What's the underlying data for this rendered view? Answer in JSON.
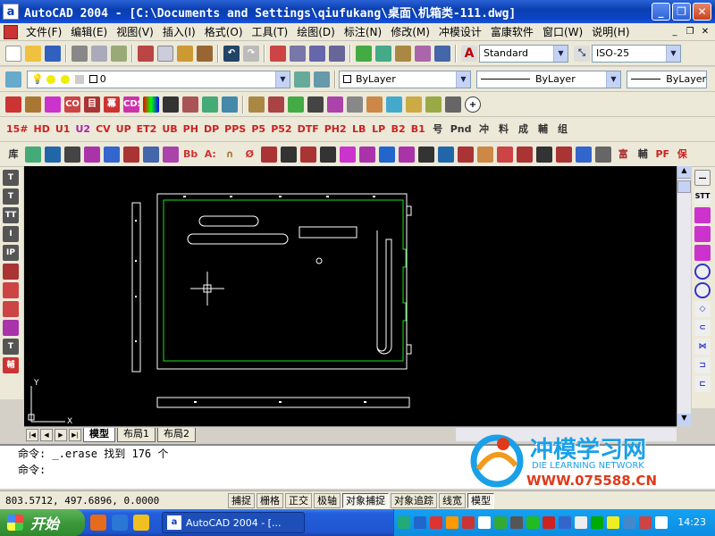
{
  "window": {
    "title": "AutoCAD 2004 - [C:\\Documents and Settings\\qiufukang\\桌面\\机箱类-111.dwg]",
    "app_icon": "a",
    "minimize_label": "_",
    "maximize_label": "❐",
    "close_label": "✕"
  },
  "menu": {
    "items": [
      "文件(F)",
      "编辑(E)",
      "视图(V)",
      "插入(I)",
      "格式(O)",
      "工具(T)",
      "绘图(D)",
      "标注(N)",
      "修改(M)",
      "冲模设计",
      "富康软件",
      "窗口(W)",
      "说明(H)"
    ],
    "mdi_min": "_",
    "mdi_restore": "❐",
    "mdi_close": "✕"
  },
  "toolbar": {
    "text_style": "Standard",
    "dim_style": "ISO-25",
    "layer": "0",
    "color": "ByLayer",
    "linetype": "ByLayer",
    "lineweight": "ByLayer"
  },
  "toolbar_labels": {
    "row1": [
      "15#",
      "HD",
      "U1",
      "U2",
      "CV",
      "UP",
      "ET2",
      "UB",
      "PH",
      "DP",
      "PPS",
      "P5",
      "P52",
      "DTF",
      "PH2",
      "LB",
      "LP",
      "B2",
      "B1",
      "号",
      "Pnd",
      "冲",
      "料",
      "成",
      "輔",
      "组"
    ],
    "row2": [
      "库",
      "",
      "",
      "",
      "",
      "",
      "",
      "",
      "",
      "Bb",
      "A:",
      "∩",
      "Ø",
      "",
      "",
      "",
      "",
      "",
      "",
      "",
      "",
      "",
      "",
      "",
      "",
      "",
      "",
      "",
      "",
      "",
      "",
      "富",
      "輔",
      "PF",
      "保"
    ]
  },
  "layout_tabs": [
    "模型",
    "布局1",
    "布局2"
  ],
  "command": {
    "line1": "命令: _.erase 找到 176 个",
    "line2": "命令:"
  },
  "status": {
    "coords": "803.5712,  497.6896, 0.0000",
    "buttons": [
      {
        "label": "捕捉",
        "on": false
      },
      {
        "label": "栅格",
        "on": false
      },
      {
        "label": "正交",
        "on": false
      },
      {
        "label": "极轴",
        "on": false
      },
      {
        "label": "对象捕捉",
        "on": true
      },
      {
        "label": "对象追踪",
        "on": false
      },
      {
        "label": "线宽",
        "on": false
      },
      {
        "label": "模型",
        "on": true
      }
    ]
  },
  "taskbar": {
    "start_label": "开始",
    "task_label": "AutoCAD 2004 - [...",
    "clock": "14:23"
  },
  "watermark": {
    "brand": "冲模学习网",
    "subtitle": "DIE LEARNING NETWORK",
    "url": "WWW.075588.CN"
  },
  "ucs": {
    "x_label": "X",
    "y_label": "Y"
  },
  "colors": {
    "drawing_background": "#000000",
    "drawing_line": "#ffffff",
    "green_line": "#19e619",
    "title_bar": "#0a3fb0"
  }
}
